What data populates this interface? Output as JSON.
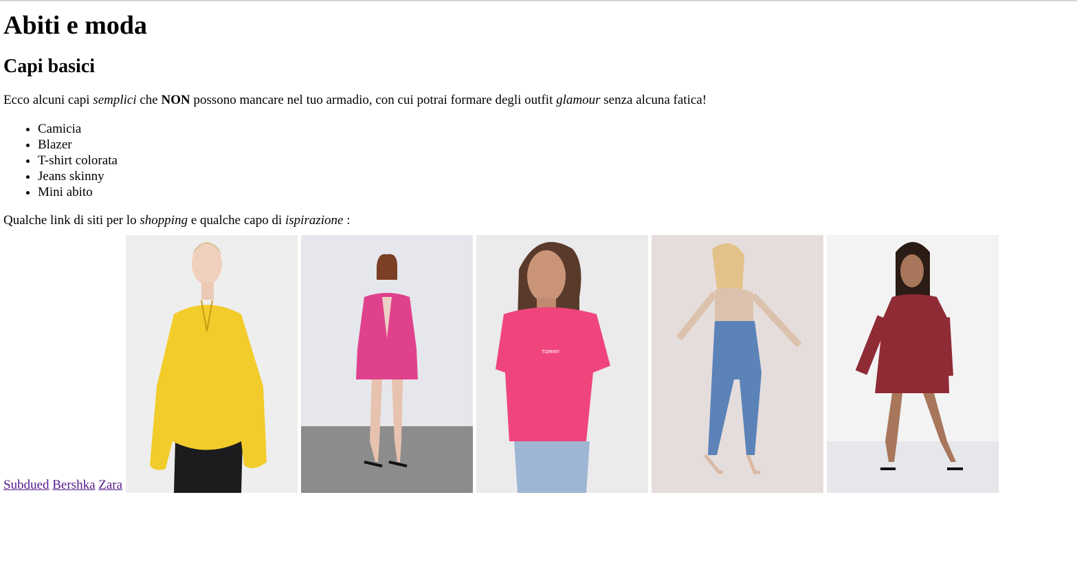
{
  "header": {
    "title": "Abiti e moda"
  },
  "section": {
    "title": "Capi basici",
    "intro": {
      "part1": "Ecco alcuni capi ",
      "em1": "semplici",
      "part2": " che ",
      "strong": "NON",
      "part3": " possono mancare nel tuo armadio, con cui potrai formare degli outfit ",
      "em2": "glamour",
      "part4": " senza alcuna fatica!"
    },
    "items": [
      "Camicia",
      "Blazer",
      "T-shirt colorata",
      "Jeans skinny",
      "Mini abito"
    ],
    "links_intro": {
      "part1": "Qualche link di siti per lo ",
      "em1": "shopping",
      "part2": " e qualche capo di ",
      "em2": "ispirazione",
      "part3": " :"
    },
    "links": [
      "Subdued",
      "Bershka",
      "Zara"
    ]
  },
  "gallery": {
    "photos": [
      {
        "subject": "yellow-blouse",
        "color": "#f2cc2a"
      },
      {
        "subject": "pink-blazer",
        "color": "#e0418c"
      },
      {
        "subject": "pink-tshirt",
        "color": "#f0457c"
      },
      {
        "subject": "skinny-jeans",
        "color": "#5b83b8"
      },
      {
        "subject": "floral-mini-dress",
        "color": "#8f2b35"
      }
    ]
  }
}
